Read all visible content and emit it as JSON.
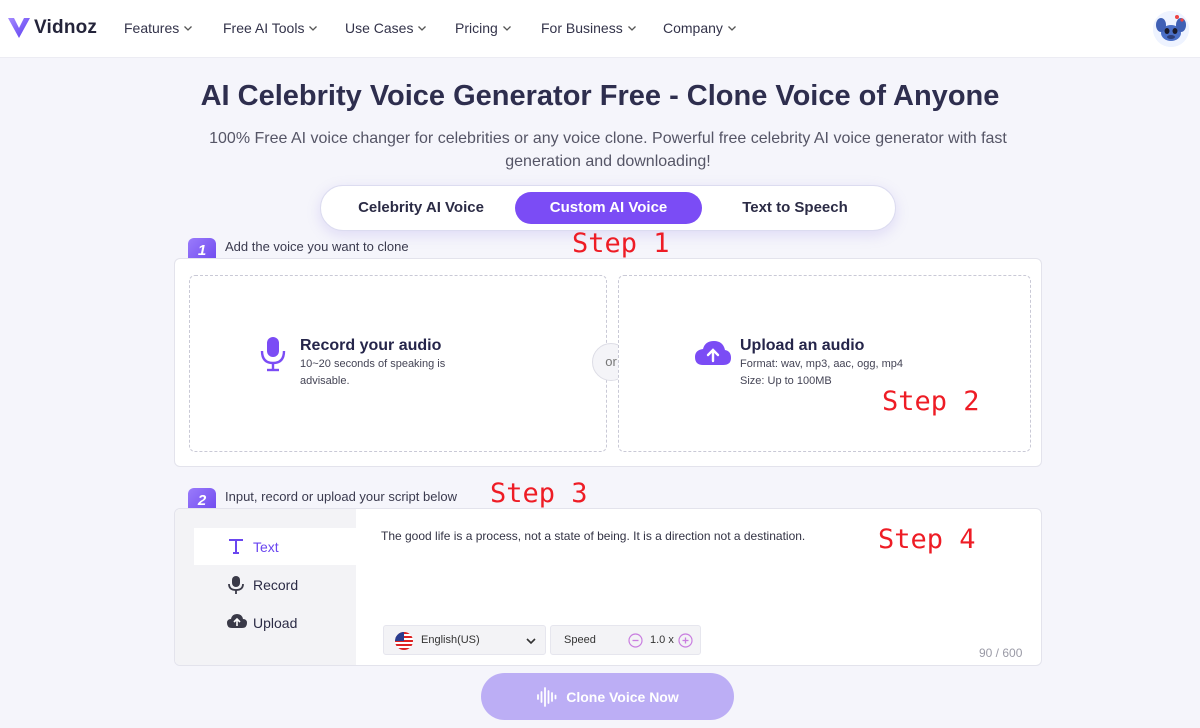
{
  "nav": {
    "logo_text": "Vidnoz",
    "items": [
      {
        "label": "Features"
      },
      {
        "label": "Free AI Tools"
      },
      {
        "label": "Use Cases"
      },
      {
        "label": "Pricing"
      },
      {
        "label": "For Business"
      },
      {
        "label": "Company"
      }
    ]
  },
  "hero": {
    "title": "AI Celebrity Voice Generator Free - Clone Voice of Anyone",
    "subtitle": "100% Free AI voice changer for celebrities or any voice clone. Powerful free celebrity AI voice generator with fast generation and downloading!"
  },
  "tabs": [
    {
      "label": "Celebrity AI Voice",
      "active": false
    },
    {
      "label": "Custom AI Voice",
      "active": true
    },
    {
      "label": "Text to Speech",
      "active": false
    }
  ],
  "step1": {
    "number": "1",
    "label": "Add the voice you want to clone",
    "record": {
      "title": "Record your audio",
      "desc": "10~20 seconds of speaking is advisable."
    },
    "or": "or",
    "upload": {
      "title": "Upload an audio",
      "format": "Format: wav, mp3, aac, ogg, mp4",
      "size": "Size: Up to 100MB"
    }
  },
  "step2": {
    "number": "2",
    "label": "Input, record or upload your script below",
    "side": [
      {
        "label": "Text",
        "icon": "text-icon",
        "active": true
      },
      {
        "label": "Record",
        "icon": "mic-icon",
        "active": false
      },
      {
        "label": "Upload",
        "icon": "cloud-upload-icon",
        "active": false
      }
    ],
    "script_text": "The good life is a process, not a state of being. It is a direction not a destination.",
    "language": "English(US)",
    "speed_label": "Speed",
    "speed_value": "1.0 x",
    "counter": "90 / 600"
  },
  "annotations": {
    "step1": "Step 1",
    "step2": "Step 2",
    "step3": "Step 3",
    "step4": "Step 4"
  },
  "button": {
    "label": "Clone Voice Now"
  },
  "colors": {
    "accent": "#7b4cf5",
    "annotation": "#ee1c25",
    "button_disabled": "#bcaef5"
  }
}
